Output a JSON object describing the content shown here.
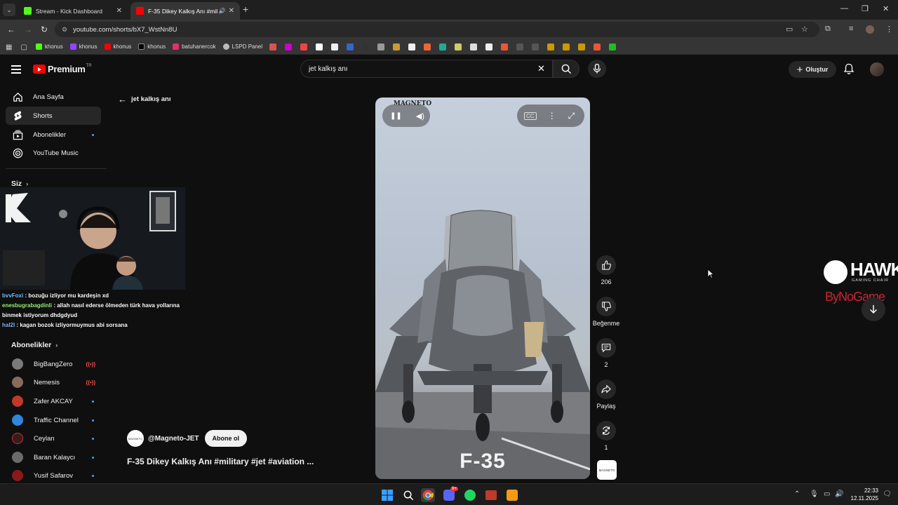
{
  "browser": {
    "tabs": [
      {
        "title": "Stream - Kick Dashboard",
        "active": false,
        "favicon_color": "#53fc18"
      },
      {
        "title": "F-35 Dikey Kalkış Anı #milit",
        "active": true,
        "favicon_color": "#ff0000"
      }
    ],
    "url": "youtube.com/shorts/bX7_WstNn8U",
    "bookmarks": [
      {
        "label": "khonus",
        "color": "#53fc18"
      },
      {
        "label": "khonus",
        "color": "#9146ff"
      },
      {
        "label": "khonus",
        "color": "#ff0000"
      },
      {
        "label": "khonus",
        "color": "#ffffff"
      },
      {
        "label": "batuhanercok",
        "color": "#e1306c"
      },
      {
        "label": "LSPD Panel",
        "color": "#cccccc"
      }
    ]
  },
  "youtube": {
    "logo_text": "Premium",
    "logo_region": "TR",
    "search_query": "jet kalkış anı",
    "create_label": "Oluştur",
    "sidebar": {
      "items": [
        {
          "label": "Ana Sayfa",
          "icon": "home-icon"
        },
        {
          "label": "Shorts",
          "icon": "shorts-icon"
        },
        {
          "label": "Abonelikler",
          "icon": "subscriptions-icon"
        },
        {
          "label": "YouTube Music",
          "icon": "music-icon"
        }
      ],
      "you_heading": "Siz",
      "subs_heading": "Abonelikler",
      "channels": [
        {
          "name": "BigBangZero",
          "status": "live",
          "color": "#7a7a7a"
        },
        {
          "name": "Nemesis",
          "status": "live",
          "color": "#8a6a5a"
        },
        {
          "name": "Zafer AKCAY",
          "status": "new",
          "color": "#c0392b"
        },
        {
          "name": "Traffic Channel",
          "status": "new",
          "color": "#2e86de"
        },
        {
          "name": "Ceylan",
          "status": "new",
          "color": "#3a1a1a"
        },
        {
          "name": "Baran Kalaycı",
          "status": "new",
          "color": "#6a6a6a"
        },
        {
          "name": "Yusif Safarov",
          "status": "new",
          "color": "#8a1a1a"
        }
      ]
    },
    "back_label": "jet kalkış anı",
    "video": {
      "brand": "MAGNETO",
      "overlay_text": "F-35",
      "channel_handle": "@Magneto-JET",
      "subscribe_label": "Abone ol",
      "title": "F-35 Dikey Kalkış Anı #military #jet #aviation ...",
      "likes": "206",
      "dislike_label": "Beğenme",
      "comments": "2",
      "share_label": "Paylaş",
      "remix_count": "1"
    },
    "sponsor": {
      "name": "HAWK",
      "sub": "GAMING CHAIR",
      "second": "ByNoGame"
    }
  },
  "stream_overlay": {
    "chat": [
      {
        "user": "bvvFoxi",
        "text": "bozuğu izliyor mu kardeşin xd"
      },
      {
        "user": "enesbugrabagdinli",
        "text": "allah nasıl ederse ölmeden türk hava yollarına binmek istiyorum dhdgdyud"
      },
      {
        "user": "hal2l",
        "text": "kagan bozok izliyormuymus abi sorsana"
      }
    ]
  },
  "taskbar": {
    "time": "22:33",
    "date": "12.11.2025",
    "discord_badge": "9+"
  }
}
